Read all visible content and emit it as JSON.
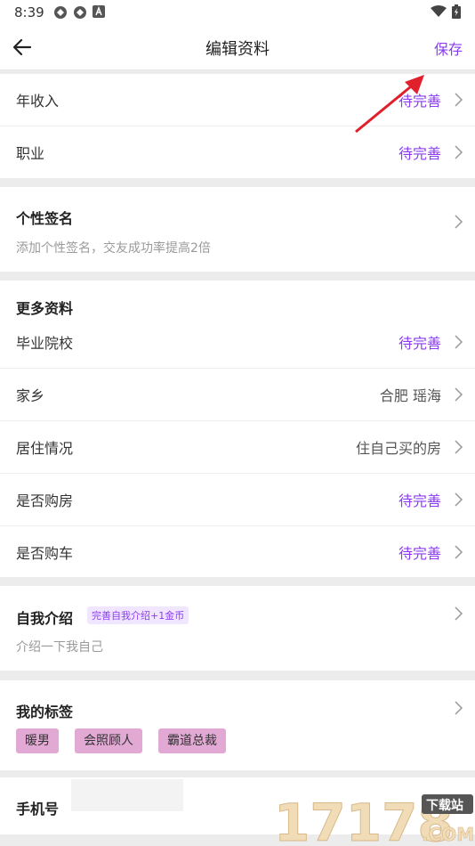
{
  "status_bar": {
    "time": "8:39",
    "left_icons": [
      "sync-icon",
      "sync-icon",
      "a-badge-icon"
    ],
    "right_icons": [
      "wifi-icon",
      "battery-icon"
    ]
  },
  "nav": {
    "title": "编辑资料",
    "save_label": "保存",
    "back_icon": "back-arrow-icon"
  },
  "top_card": {
    "rows": [
      {
        "label": "年收入",
        "value": "待完善",
        "status": "pending"
      },
      {
        "label": "职业",
        "value": "待完善",
        "status": "pending"
      }
    ]
  },
  "signature": {
    "title": "个性签名",
    "placeholder": "添加个性签名，交友成功率提高2倍"
  },
  "more_info": {
    "title": "更多资料",
    "rows": [
      {
        "label": "毕业院校",
        "value": "待完善",
        "status": "pending"
      },
      {
        "label": "家乡",
        "value": "合肥 瑶海",
        "status": "filled"
      },
      {
        "label": "居住情况",
        "value": "住自己买的房",
        "status": "filled"
      },
      {
        "label": "是否购房",
        "value": "待完善",
        "status": "pending"
      },
      {
        "label": "是否购车",
        "value": "待完善",
        "status": "pending"
      }
    ]
  },
  "self_intro": {
    "title": "自我介绍",
    "badge": "完善自我介绍+1金币",
    "placeholder": "介绍一下我自己"
  },
  "my_tags": {
    "title": "我的标签",
    "tags": [
      "暖男",
      "会照顾人",
      "霸道总裁"
    ]
  },
  "phone": {
    "label": "手机号"
  },
  "watermark": {
    "brand": "17178",
    "site": "下载站",
    "domain": ".COM"
  },
  "colors": {
    "accent": "#8a3cf0",
    "tag_bg": "#e3a9d5",
    "annotation_arrow": "#e0202a"
  }
}
